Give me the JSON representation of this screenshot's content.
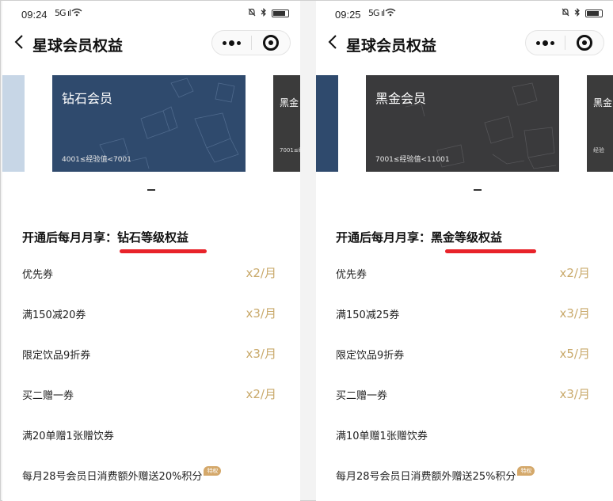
{
  "colors": {
    "accent_gold": "#c9a96a",
    "highlight_red": "#e8232a",
    "diamond_card": "#2f4a6d",
    "blackgold_card": "#3a3a3c"
  },
  "left": {
    "status": {
      "time": "09:24",
      "signal": "5G ıl",
      "wifi_icon": "wifi-icon",
      "silent_icon": "bell-off-icon",
      "bluetooth_icon": "bluetooth-icon"
    },
    "nav": {
      "title": "星球会员权益",
      "back_icon": "chevron-left-icon",
      "more_icon": "more-icon",
      "close_icon": "target-close-icon"
    },
    "card": {
      "name": "钻石会员",
      "range": "4001≤经验值<7001"
    },
    "peek_right": {
      "name": "黑金",
      "range": "7001≤经"
    },
    "section": {
      "prefix": "开通后每月月享：",
      "level": "钻石等级权益"
    },
    "benefits": [
      {
        "label": "优先券",
        "qty": "x2/月"
      },
      {
        "label": "满150减20券",
        "qty": "x3/月"
      },
      {
        "label": "限定饮品9折券",
        "qty": "x3/月"
      },
      {
        "label": "买二赠一券",
        "qty": "x2/月"
      },
      {
        "label": "满20单赠1张赠饮券",
        "qty": ""
      },
      {
        "label": "每月28号会员日消费额外赠送20%积分",
        "qty": "",
        "badge": "特权"
      }
    ]
  },
  "right": {
    "status": {
      "time": "09:25",
      "signal": "5G ıl",
      "wifi_icon": "wifi-icon",
      "silent_icon": "bell-off-icon",
      "bluetooth_icon": "bluetooth-icon"
    },
    "nav": {
      "title": "星球会员权益",
      "back_icon": "chevron-left-icon",
      "more_icon": "more-icon",
      "close_icon": "target-close-icon"
    },
    "card": {
      "name": "黑金会员",
      "range": "7001≤经验值<11001"
    },
    "peek_right": {
      "name": "黑金",
      "range": "经验"
    },
    "section": {
      "prefix": "开通后每月月享：",
      "level": "黑金等级权益"
    },
    "benefits": [
      {
        "label": "优先券",
        "qty": "x2/月"
      },
      {
        "label": "满150减25券",
        "qty": "x3/月"
      },
      {
        "label": "限定饮品9折券",
        "qty": "x5/月"
      },
      {
        "label": "买二赠一券",
        "qty": "x3/月"
      },
      {
        "label": "满10单赠1张赠饮券",
        "qty": ""
      },
      {
        "label": "每月28号会员日消费额外赠送25%积分",
        "qty": "",
        "badge": "特权"
      }
    ]
  }
}
